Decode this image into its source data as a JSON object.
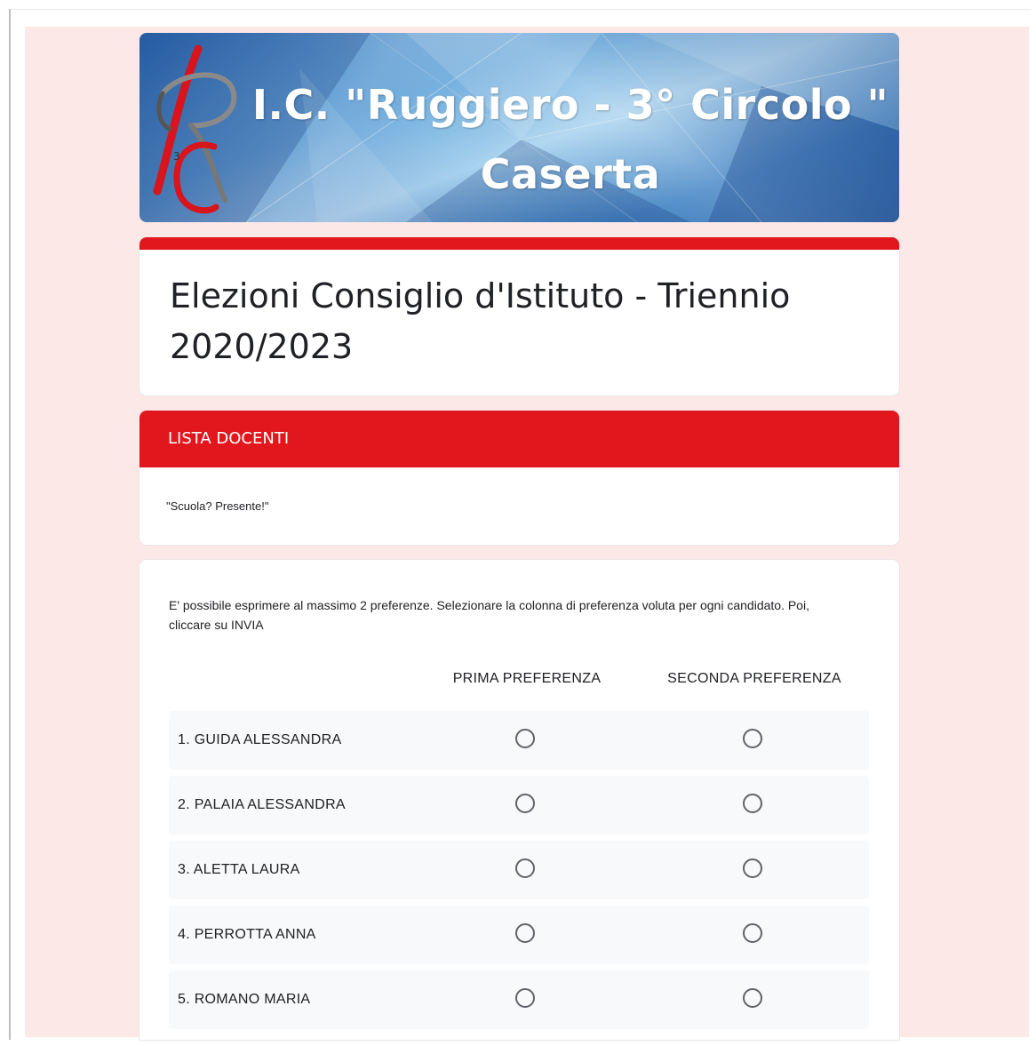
{
  "banner": {
    "title_line1": "I.C. \"Ruggiero - 3°  Circolo \"",
    "title_line2": "Caserta",
    "logo_text": "R3C"
  },
  "form": {
    "title": "Elezioni Consiglio d'Istituto - Triennio 2020/2023",
    "accent_color": "#e2171d"
  },
  "section": {
    "header": "LISTA DOCENTI",
    "description": "\"Scuola? Presente!\""
  },
  "question": {
    "text": "E' possibile esprimere al massimo 2 preferenze. Selezionare la colonna di preferenza voluta per ogni candidato. Poi, cliccare su INVIA",
    "columns": [
      "PRIMA PREFERENZA",
      "SECONDA PREFERENZA"
    ],
    "rows": [
      {
        "label": "1. GUIDA ALESSANDRA"
      },
      {
        "label": "2. PALAIA ALESSANDRA"
      },
      {
        "label": "3. ALETTA LAURA"
      },
      {
        "label": "4. PERROTTA ANNA"
      },
      {
        "label": "5. ROMANO MARIA"
      }
    ]
  },
  "colors": {
    "page_background": "#fde8e8",
    "red": "#e2171d",
    "row_background": "#f8f9fa"
  }
}
